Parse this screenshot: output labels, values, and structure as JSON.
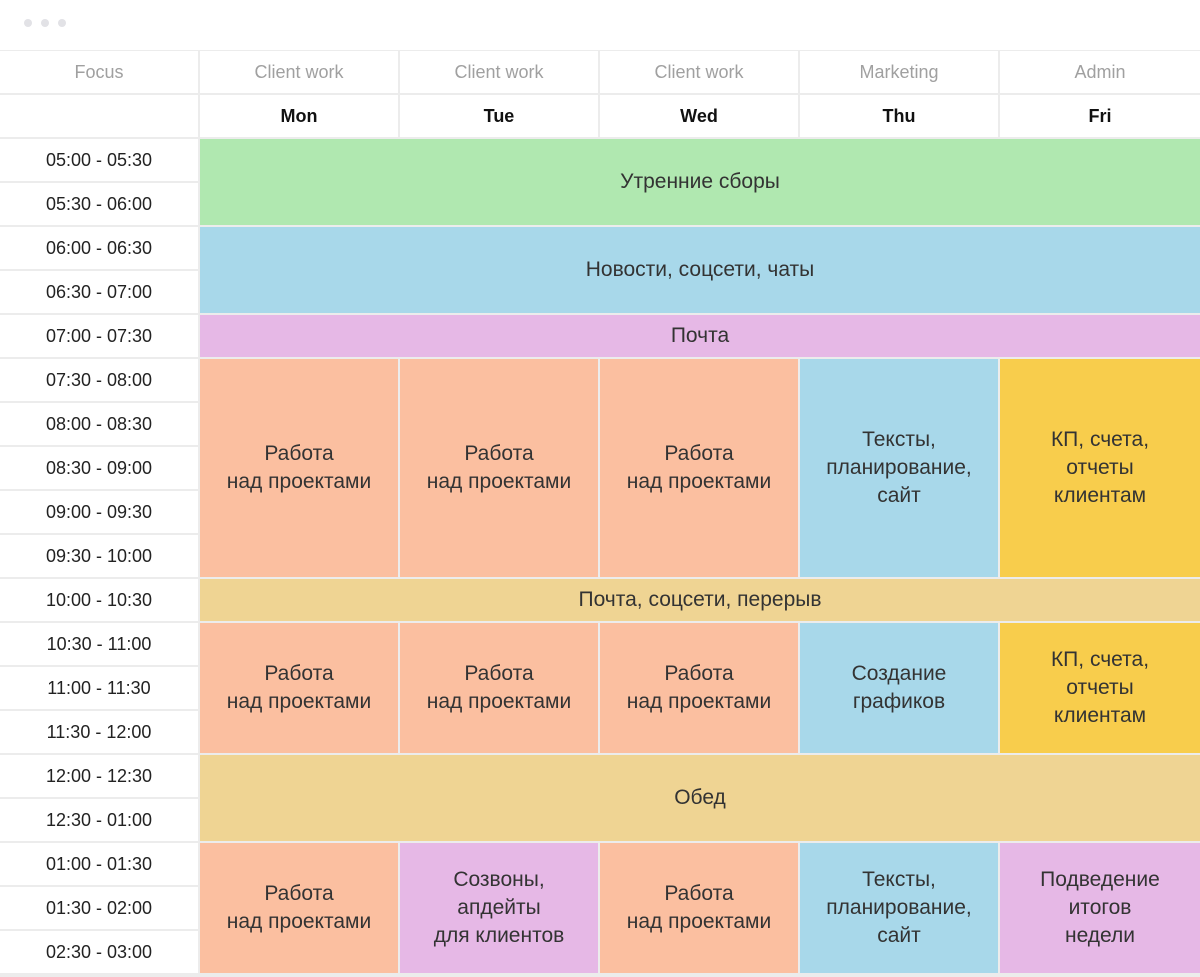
{
  "window": {
    "controls": [
      "dot",
      "dot",
      "dot"
    ]
  },
  "header": {
    "focus_label": "Focus",
    "columns": [
      {
        "focus": "Client work",
        "day": "Mon"
      },
      {
        "focus": "Client work",
        "day": "Tue"
      },
      {
        "focus": "Client work",
        "day": "Wed"
      },
      {
        "focus": "Marketing",
        "day": "Thu"
      },
      {
        "focus": "Admin",
        "day": "Fri"
      }
    ]
  },
  "times": [
    "05:00 - 05:30",
    "05:30 - 06:00",
    "06:00 - 06:30",
    "06:30 - 07:00",
    "07:00 - 07:30",
    "07:30 - 08:00",
    "08:00 - 08:30",
    "08:30 - 09:00",
    "09:00 - 09:30",
    "09:30 - 10:00",
    "10:00 - 10:30",
    "10:30 - 11:00",
    "11:00 - 11:30",
    "11:30 - 12:00",
    "12:00 - 12:30",
    "12:30 - 01:00",
    "01:00 - 01:30",
    "01:30 - 02:00",
    "02:30 - 03:00"
  ],
  "colors": {
    "green": "#b0e8b0",
    "blue": "#a8d8ea",
    "purple": "#e6b8e6",
    "salmon": "#fbbfa0",
    "tan": "#efd493",
    "yellow": "#f8cd4c"
  },
  "blocks": [
    {
      "label": "Утренние сборы",
      "color": "green",
      "col": 0,
      "span_cols": 5,
      "row": 0,
      "span_rows": 2
    },
    {
      "label": "Новости, соцсети, чаты",
      "color": "blue",
      "col": 0,
      "span_cols": 5,
      "row": 2,
      "span_rows": 2
    },
    {
      "label": "Почта",
      "color": "purple",
      "col": 0,
      "span_cols": 5,
      "row": 4,
      "span_rows": 1
    },
    {
      "label": "Работа\nнад проектами",
      "color": "salmon",
      "col": 0,
      "span_cols": 1,
      "row": 5,
      "span_rows": 5
    },
    {
      "label": "Работа\nнад проектами",
      "color": "salmon",
      "col": 1,
      "span_cols": 1,
      "row": 5,
      "span_rows": 5
    },
    {
      "label": "Работа\nнад проектами",
      "color": "salmon",
      "col": 2,
      "span_cols": 1,
      "row": 5,
      "span_rows": 5
    },
    {
      "label": "Тексты,\nпланирование,\nсайт",
      "color": "blue",
      "col": 3,
      "span_cols": 1,
      "row": 5,
      "span_rows": 5
    },
    {
      "label": "КП, счета,\nотчеты\nклиентам",
      "color": "yellow",
      "col": 4,
      "span_cols": 1,
      "row": 5,
      "span_rows": 5
    },
    {
      "label": "Почта, соцсети, перерыв",
      "color": "tan",
      "col": 0,
      "span_cols": 5,
      "row": 10,
      "span_rows": 1
    },
    {
      "label": "Работа\nнад проектами",
      "color": "salmon",
      "col": 0,
      "span_cols": 1,
      "row": 11,
      "span_rows": 3
    },
    {
      "label": "Работа\nнад проектами",
      "color": "salmon",
      "col": 1,
      "span_cols": 1,
      "row": 11,
      "span_rows": 3
    },
    {
      "label": "Работа\nнад проектами",
      "color": "salmon",
      "col": 2,
      "span_cols": 1,
      "row": 11,
      "span_rows": 3
    },
    {
      "label": "Создание\nграфиков",
      "color": "blue",
      "col": 3,
      "span_cols": 1,
      "row": 11,
      "span_rows": 3
    },
    {
      "label": "КП, счета,\nотчеты\nклиентам",
      "color": "yellow",
      "col": 4,
      "span_cols": 1,
      "row": 11,
      "span_rows": 3
    },
    {
      "label": "Обед",
      "color": "tan",
      "col": 0,
      "span_cols": 5,
      "row": 14,
      "span_rows": 2
    },
    {
      "label": "Работа\nнад проектами",
      "color": "salmon",
      "col": 0,
      "span_cols": 1,
      "row": 16,
      "span_rows": 3
    },
    {
      "label": "Созвоны,\nапдейты\nдля клиентов",
      "color": "purple",
      "col": 1,
      "span_cols": 1,
      "row": 16,
      "span_rows": 3
    },
    {
      "label": "Работа\nнад проектами",
      "color": "salmon",
      "col": 2,
      "span_cols": 1,
      "row": 16,
      "span_rows": 3
    },
    {
      "label": "Тексты,\nпланирование,\nсайт",
      "color": "blue",
      "col": 3,
      "span_cols": 1,
      "row": 16,
      "span_rows": 3
    },
    {
      "label": "Подведение\nитогов\nнедели",
      "color": "purple",
      "col": 4,
      "span_cols": 1,
      "row": 16,
      "span_rows": 3
    }
  ]
}
